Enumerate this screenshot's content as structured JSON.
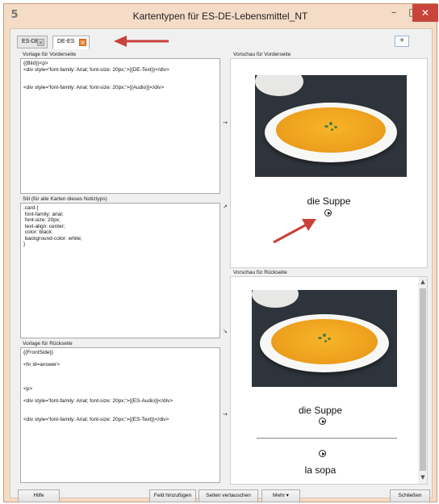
{
  "window": {
    "title": "Kartentypen für ES-DE-Lebensmittel_NT",
    "minimize_glyph": "–",
    "maximize_glyph": "□",
    "close_glyph": "✕",
    "app_icon_glyph": "5"
  },
  "tabs": [
    {
      "label": "ES-DE",
      "active": false
    },
    {
      "label": "DE-ES",
      "active": true
    }
  ],
  "add_tab_label": "+",
  "front_template": {
    "label": "Vorlage für Vorderseite",
    "content": "{{Bild}}<p>\n<div style='font-family: Arial; font-size: 20px;'>{{DE-Text}}</div>\n\n\n<div style='font-family: Arial; font-size: 20px;'>{{Audio}}</div>"
  },
  "styling": {
    "label": "Stil (für alle Karten dieses Notiztyps)",
    "content": ".card {\n font-family: arial;\n font-size: 20px;\n text-align: center;\n color: black;\n background-color: white;\n}"
  },
  "back_template": {
    "label": "Vorlage für Rückseite",
    "content": "{{FrontSide}}\n\n<hr id=answer>\n\n\n\n<p>\n\n<div style='font-family: Arial; font-size: 20px;'>{{ES-Audio}}</div>\n\n\n<div style='font-family: Arial; font-size: 20px;'>{{ES-Text}}</div>"
  },
  "front_preview": {
    "label": "Vorschau für Vorderseite",
    "word": "die Suppe"
  },
  "back_preview": {
    "label": "Vorschau für Rückseite",
    "word_front": "die Suppe",
    "word_back": "la sopa"
  },
  "arrows": {
    "right": "→",
    "diag_up": "↗",
    "diag_down": "↘",
    "scroll_up": "▲",
    "scroll_down": "▼"
  },
  "buttons": {
    "help": "Hilfe",
    "add_field": "Feld hinzufügen",
    "swap_sides": "Seiten vertauschen",
    "more": "Mehr ▾",
    "close": "Schließen"
  },
  "colors": {
    "annotation_arrow": "#c9413b",
    "window_frame": "#f4dcc6",
    "close_button": "#c9453b"
  }
}
